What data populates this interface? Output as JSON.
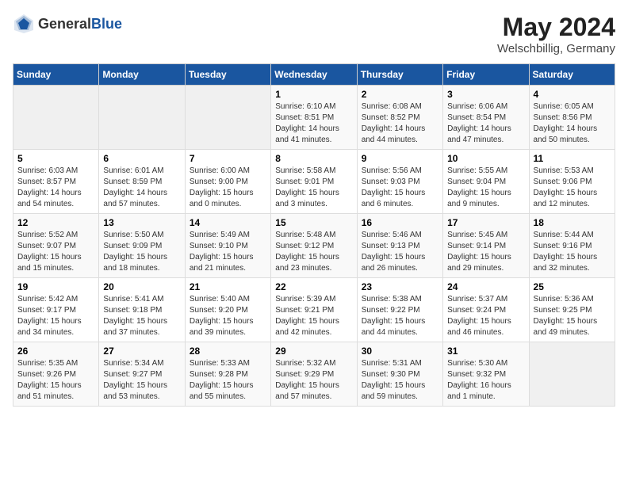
{
  "header": {
    "logo_general": "General",
    "logo_blue": "Blue",
    "month_year": "May 2024",
    "location": "Welschbillig, Germany"
  },
  "days_of_week": [
    "Sunday",
    "Monday",
    "Tuesday",
    "Wednesday",
    "Thursday",
    "Friday",
    "Saturday"
  ],
  "weeks": [
    {
      "days": [
        {
          "num": "",
          "info": ""
        },
        {
          "num": "",
          "info": ""
        },
        {
          "num": "",
          "info": ""
        },
        {
          "num": "1",
          "info": "Sunrise: 6:10 AM\nSunset: 8:51 PM\nDaylight: 14 hours\nand 41 minutes."
        },
        {
          "num": "2",
          "info": "Sunrise: 6:08 AM\nSunset: 8:52 PM\nDaylight: 14 hours\nand 44 minutes."
        },
        {
          "num": "3",
          "info": "Sunrise: 6:06 AM\nSunset: 8:54 PM\nDaylight: 14 hours\nand 47 minutes."
        },
        {
          "num": "4",
          "info": "Sunrise: 6:05 AM\nSunset: 8:56 PM\nDaylight: 14 hours\nand 50 minutes."
        }
      ]
    },
    {
      "days": [
        {
          "num": "5",
          "info": "Sunrise: 6:03 AM\nSunset: 8:57 PM\nDaylight: 14 hours\nand 54 minutes."
        },
        {
          "num": "6",
          "info": "Sunrise: 6:01 AM\nSunset: 8:59 PM\nDaylight: 14 hours\nand 57 minutes."
        },
        {
          "num": "7",
          "info": "Sunrise: 6:00 AM\nSunset: 9:00 PM\nDaylight: 15 hours\nand 0 minutes."
        },
        {
          "num": "8",
          "info": "Sunrise: 5:58 AM\nSunset: 9:01 PM\nDaylight: 15 hours\nand 3 minutes."
        },
        {
          "num": "9",
          "info": "Sunrise: 5:56 AM\nSunset: 9:03 PM\nDaylight: 15 hours\nand 6 minutes."
        },
        {
          "num": "10",
          "info": "Sunrise: 5:55 AM\nSunset: 9:04 PM\nDaylight: 15 hours\nand 9 minutes."
        },
        {
          "num": "11",
          "info": "Sunrise: 5:53 AM\nSunset: 9:06 PM\nDaylight: 15 hours\nand 12 minutes."
        }
      ]
    },
    {
      "days": [
        {
          "num": "12",
          "info": "Sunrise: 5:52 AM\nSunset: 9:07 PM\nDaylight: 15 hours\nand 15 minutes."
        },
        {
          "num": "13",
          "info": "Sunrise: 5:50 AM\nSunset: 9:09 PM\nDaylight: 15 hours\nand 18 minutes."
        },
        {
          "num": "14",
          "info": "Sunrise: 5:49 AM\nSunset: 9:10 PM\nDaylight: 15 hours\nand 21 minutes."
        },
        {
          "num": "15",
          "info": "Sunrise: 5:48 AM\nSunset: 9:12 PM\nDaylight: 15 hours\nand 23 minutes."
        },
        {
          "num": "16",
          "info": "Sunrise: 5:46 AM\nSunset: 9:13 PM\nDaylight: 15 hours\nand 26 minutes."
        },
        {
          "num": "17",
          "info": "Sunrise: 5:45 AM\nSunset: 9:14 PM\nDaylight: 15 hours\nand 29 minutes."
        },
        {
          "num": "18",
          "info": "Sunrise: 5:44 AM\nSunset: 9:16 PM\nDaylight: 15 hours\nand 32 minutes."
        }
      ]
    },
    {
      "days": [
        {
          "num": "19",
          "info": "Sunrise: 5:42 AM\nSunset: 9:17 PM\nDaylight: 15 hours\nand 34 minutes."
        },
        {
          "num": "20",
          "info": "Sunrise: 5:41 AM\nSunset: 9:18 PM\nDaylight: 15 hours\nand 37 minutes."
        },
        {
          "num": "21",
          "info": "Sunrise: 5:40 AM\nSunset: 9:20 PM\nDaylight: 15 hours\nand 39 minutes."
        },
        {
          "num": "22",
          "info": "Sunrise: 5:39 AM\nSunset: 9:21 PM\nDaylight: 15 hours\nand 42 minutes."
        },
        {
          "num": "23",
          "info": "Sunrise: 5:38 AM\nSunset: 9:22 PM\nDaylight: 15 hours\nand 44 minutes."
        },
        {
          "num": "24",
          "info": "Sunrise: 5:37 AM\nSunset: 9:24 PM\nDaylight: 15 hours\nand 46 minutes."
        },
        {
          "num": "25",
          "info": "Sunrise: 5:36 AM\nSunset: 9:25 PM\nDaylight: 15 hours\nand 49 minutes."
        }
      ]
    },
    {
      "days": [
        {
          "num": "26",
          "info": "Sunrise: 5:35 AM\nSunset: 9:26 PM\nDaylight: 15 hours\nand 51 minutes."
        },
        {
          "num": "27",
          "info": "Sunrise: 5:34 AM\nSunset: 9:27 PM\nDaylight: 15 hours\nand 53 minutes."
        },
        {
          "num": "28",
          "info": "Sunrise: 5:33 AM\nSunset: 9:28 PM\nDaylight: 15 hours\nand 55 minutes."
        },
        {
          "num": "29",
          "info": "Sunrise: 5:32 AM\nSunset: 9:29 PM\nDaylight: 15 hours\nand 57 minutes."
        },
        {
          "num": "30",
          "info": "Sunrise: 5:31 AM\nSunset: 9:30 PM\nDaylight: 15 hours\nand 59 minutes."
        },
        {
          "num": "31",
          "info": "Sunrise: 5:30 AM\nSunset: 9:32 PM\nDaylight: 16 hours\nand 1 minute."
        },
        {
          "num": "",
          "info": ""
        }
      ]
    }
  ]
}
